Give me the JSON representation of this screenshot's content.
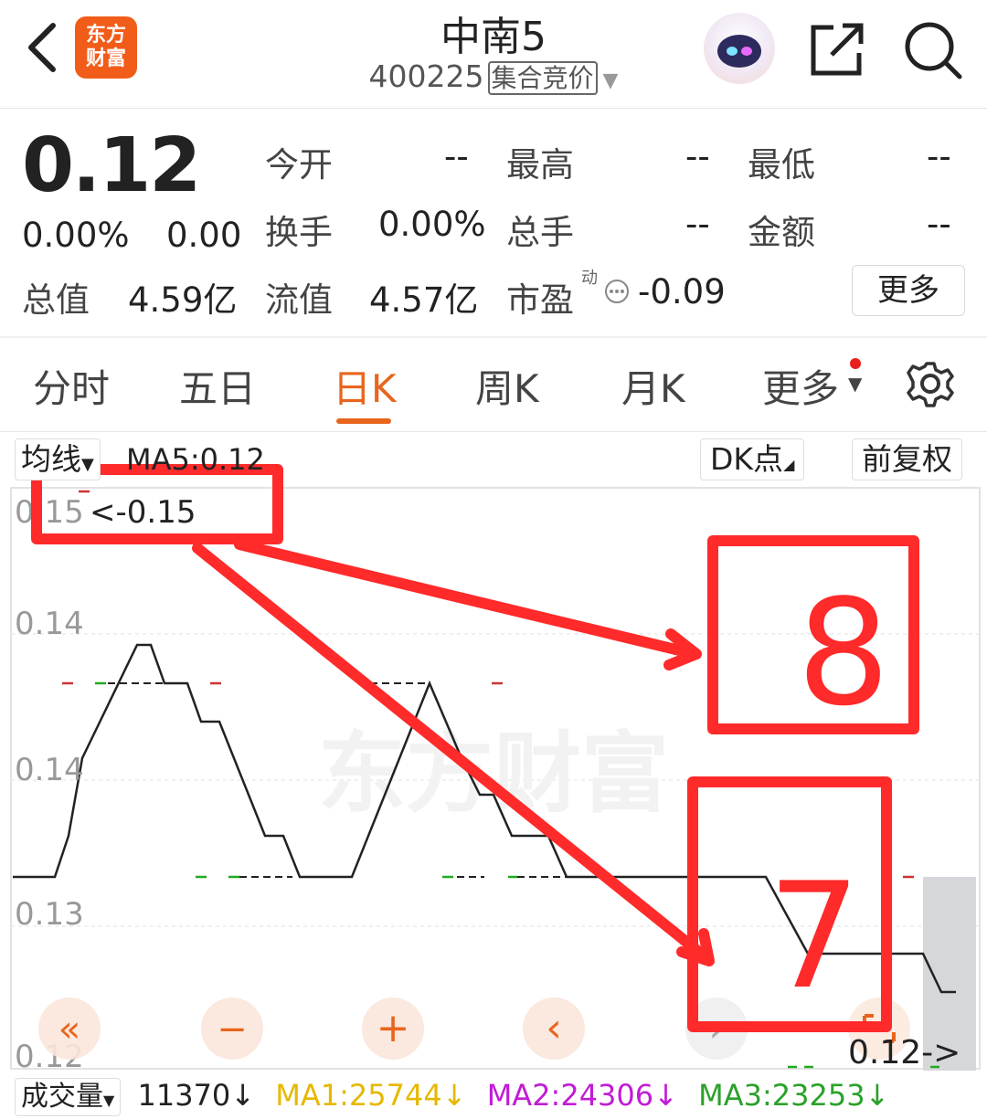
{
  "header": {
    "back_icon": "chevron-left-icon",
    "logo_line1": "东方",
    "logo_line2": "财富",
    "title": "中南5",
    "code": "400225",
    "status_tag": "集合竞价",
    "avatar_icon": "robot-avatar-icon",
    "share_icon": "share-icon",
    "search_icon": "search-icon"
  },
  "quote": {
    "price": "0.12",
    "change_pct": "0.00%",
    "change": "0.00",
    "open_label": "今开",
    "open": "--",
    "high_label": "最高",
    "high": "--",
    "low_label": "最低",
    "low": "--",
    "turnover_label": "换手",
    "turnover": "0.00%",
    "volume_label": "总手",
    "volume": "--",
    "amount_label": "金额",
    "amount": "--",
    "mktcap_label": "总值",
    "mktcap": "4.59亿",
    "float_label": "流值",
    "float_cap": "4.57亿",
    "pe_label": "市盈",
    "pe_sup": "动",
    "pe": "-0.09",
    "more_button": "更多"
  },
  "tabs": [
    {
      "label": "分时"
    },
    {
      "label": "五日"
    },
    {
      "label": "日K"
    },
    {
      "label": "周K"
    },
    {
      "label": "月K"
    },
    {
      "label": "更多"
    }
  ],
  "active_tab": "日K",
  "toolbar": {
    "ma_select": "均线",
    "ma5": "MA5:0.12",
    "dk_button": "DK点",
    "adjust_button": "前复权"
  },
  "chart_data": {
    "type": "line",
    "y_tick_labels": [
      "0.15",
      "0.14",
      "0.14",
      "0.13",
      "0.12"
    ],
    "max_marker": "<-0.15",
    "last_marker": "0.12->",
    "watermark": "东方财富",
    "annotations": [
      "8",
      "7"
    ],
    "accent_color": "#e8651d",
    "annotation_color": "#ff2a2a"
  },
  "nav_buttons": [
    "«",
    "−",
    "+",
    "‹",
    "›"
  ],
  "volume_bar": {
    "select": "成交量",
    "value": "11370",
    "ma1": "MA1:25744",
    "ma2": "MA2:24306",
    "ma3": "MA3:23253",
    "ma1_color": "#e6b800",
    "ma2_color": "#c21bd6",
    "ma3_color": "#2aa12a"
  }
}
